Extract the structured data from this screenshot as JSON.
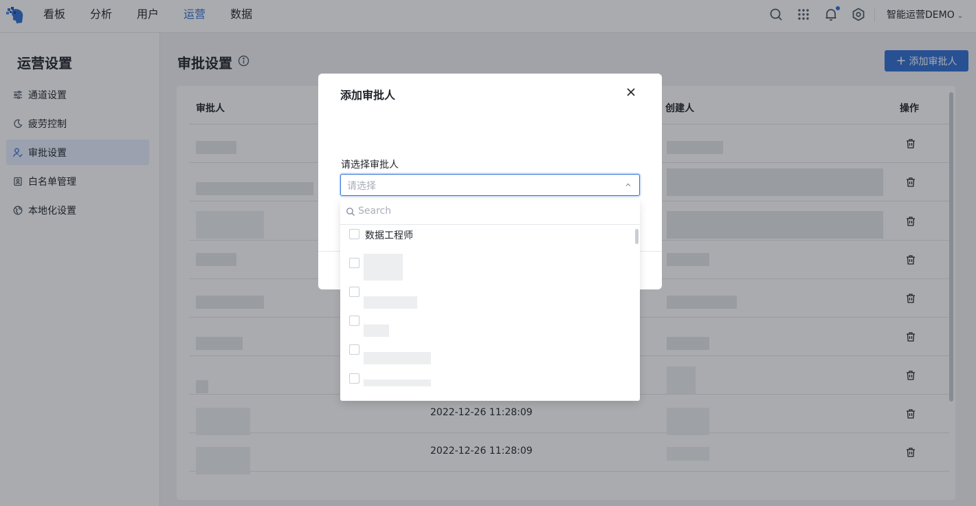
{
  "nav": {
    "items": [
      "看板",
      "分析",
      "用户",
      "运营",
      "数据"
    ],
    "active_index": 3,
    "account_label": "智能运营DEMO"
  },
  "sidebar": {
    "title": "运营设置",
    "items": [
      "通道设置",
      "疲劳控制",
      "审批设置",
      "白名单管理",
      "本地化设置"
    ],
    "active_index": 2
  },
  "main": {
    "title": "审批设置",
    "add_button": "添加审批人",
    "columns": {
      "approver": "审批人",
      "creator": "创建人",
      "actions": "操作"
    },
    "visible_dates": [
      "2022-12-26 11:28:09",
      "2022-12-26 11:28:09"
    ]
  },
  "modal": {
    "title": "添加审批人",
    "field_label": "请选择审批人",
    "select_placeholder": "请选择",
    "search_placeholder": "Search",
    "first_option": "数据工程师"
  },
  "colors": {
    "accent": "#2f6fd6",
    "selected_bg": "#e8efff"
  }
}
